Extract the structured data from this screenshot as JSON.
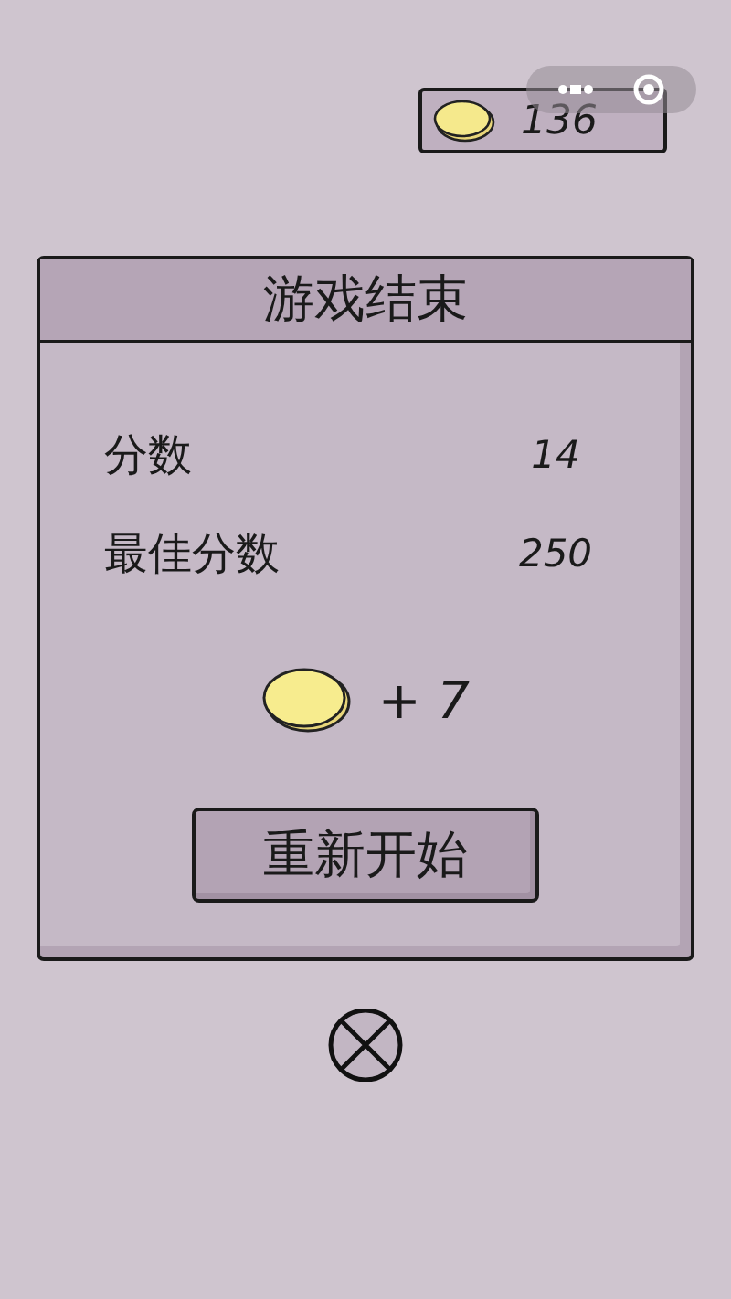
{
  "coins": {
    "count": "136"
  },
  "dialog": {
    "title": "游戏结束",
    "stats": [
      {
        "label": "分数",
        "value": "14"
      },
      {
        "label": "最佳分数",
        "value": "250"
      }
    ],
    "reward": "+ 7",
    "button": "重新开始"
  }
}
